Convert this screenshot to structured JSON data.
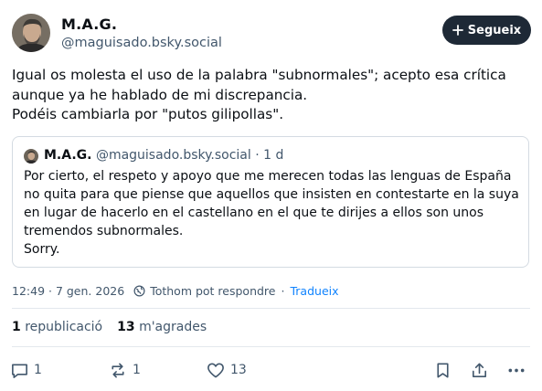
{
  "author": {
    "name": "M.A.G.",
    "handle": "@maguisado.bsky.social"
  },
  "follow_button": {
    "label": "Segueix"
  },
  "post": {
    "lines": [
      "Igual os molesta el uso de la palabra \"subnormales\"; acepto esa crítica",
      "aunque ya he hablado de mi discrepancia.",
      "Podéis cambiarla por \"putos gilipollas\"."
    ]
  },
  "quote": {
    "name": "M.A.G.",
    "handle": "@maguisado.bsky.social",
    "age": "· 1 d",
    "lines": [
      "Por cierto, el respeto y apoyo que me merecen todas las lenguas de España",
      "no quita para que piense que aquellos que insisten en contestarte en la suya",
      "en lugar de hacerlo en el castellano en el que te dirijes a ellos son unos",
      "tremendos subnormales.",
      "Sorry."
    ]
  },
  "meta": {
    "timestamp": "12:49 · 7 gen. 2026",
    "sep": "·",
    "reply_policy": "Tothom pot respondre",
    "translate": "Tradueix"
  },
  "stats": {
    "reposts_count": "1",
    "reposts_label": "republicació",
    "likes_count": "13",
    "likes_label": "m'agrades"
  },
  "actions": {
    "reply_count": "1",
    "repost_count": "1",
    "like_count": "13"
  },
  "colors": {
    "primary_text": "#0b0f14",
    "secondary_text": "#42576c",
    "link": "#1083fe",
    "button_bg": "#1e2936",
    "border": "#d4dbe2"
  },
  "icons": [
    "plus-icon",
    "globe-icon",
    "reply-icon",
    "repost-icon",
    "like-icon",
    "bookmark-icon",
    "share-icon",
    "more-icon"
  ]
}
